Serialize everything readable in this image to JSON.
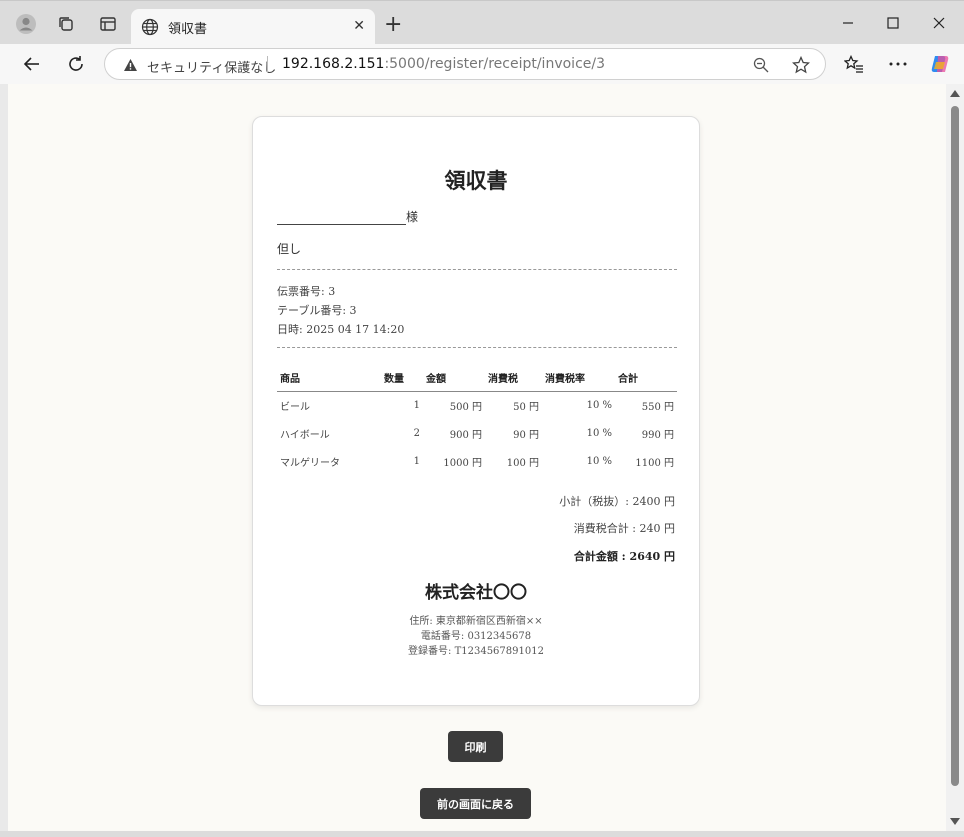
{
  "browser": {
    "tab_title": "領収書",
    "security_label": "セキュリティ保護なし",
    "url_host": "192.168.2.151",
    "url_rest": ":5000/register/receipt/invoice/3"
  },
  "receipt": {
    "title": "領収書",
    "honorific": "様",
    "tadashi": "但し",
    "slip_no": "伝票番号: 3",
    "table_no": "テーブル番号: 3",
    "datetime": "日時: 2025 04 17 14:20",
    "headers": [
      "商品",
      "数量",
      "金額",
      "消費税",
      "消費税率",
      "合計"
    ],
    "rows": [
      {
        "name": "ビール",
        "qty": "1",
        "amount": "500 円",
        "tax": "50 円",
        "rate": "10 %",
        "total": "550 円"
      },
      {
        "name": "ハイボール",
        "qty": "2",
        "amount": "900 円",
        "tax": "90 円",
        "rate": "10 %",
        "total": "990 円"
      },
      {
        "name": "マルゲリータ",
        "qty": "1",
        "amount": "1000 円",
        "tax": "100 円",
        "rate": "10 %",
        "total": "1100 円"
      }
    ],
    "subtotal": "小計（税抜）: 2400 円",
    "tax_total": "消費税合計 : 240 円",
    "grand_total": "合計金額 : 2640 円",
    "company": "株式会社〇〇",
    "address": "住所: 東京都新宿区西新宿××",
    "phone": "電話番号: 0312345678",
    "registration": "登録番号: T1234567891012"
  },
  "buttons": {
    "print": "印刷",
    "back": "前の画面に戻る"
  }
}
